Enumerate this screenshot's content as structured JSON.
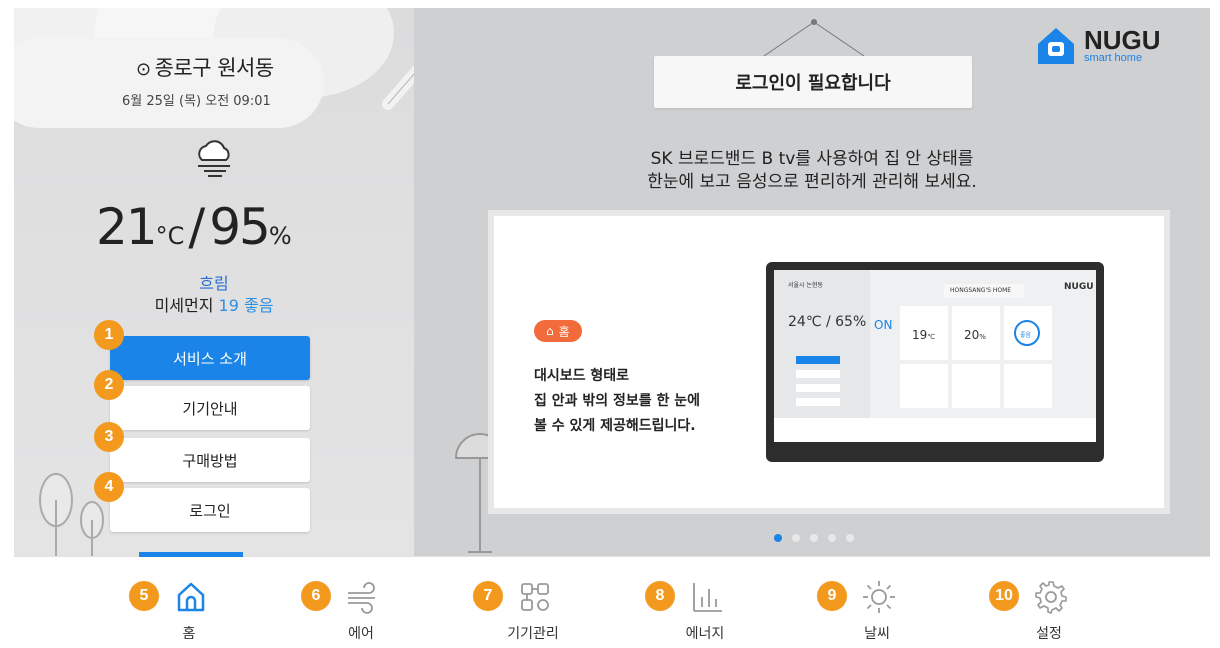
{
  "location": {
    "label": "종로구 원서동",
    "datetime": "6월 25일 (목) 오전 09:01"
  },
  "weather": {
    "temp_value": "21",
    "temp_unit": "°C",
    "humid_value": "95",
    "humid_unit": "%",
    "condition": "흐림",
    "dust_label": "미세먼지",
    "dust_value": "19 좋음"
  },
  "menu": {
    "items": [
      {
        "badge": "1",
        "label": "서비스 소개"
      },
      {
        "badge": "2",
        "label": "기기안내"
      },
      {
        "badge": "3",
        "label": "구매방법"
      },
      {
        "badge": "4",
        "label": "로그인"
      }
    ]
  },
  "main": {
    "sign": "로그인이 필요합니다",
    "desc_line1": "SK 브로드밴드 B tv를 사용하여 집 안 상태를",
    "desc_line2": "한눈에 보고 음성으로 편리하게 관리해 보세요.",
    "slide": {
      "tag": "홈",
      "line1": "대시보드 형태로",
      "line2": "집 안과 밖의 정보를 한 눈에",
      "line3": "볼 수 있게 제공해드립니다.",
      "tv": {
        "location": "서울시 논현동",
        "home_name": "HONGSANG'S HOME",
        "brand": "NUGU",
        "temp": "24℃ / 65%",
        "on_label": "ON",
        "tile1_value": "19",
        "tile1_unit": "℃",
        "tile2_value": "20",
        "tile2_unit": "%",
        "tile3_label": "좋음"
      }
    },
    "pagination": {
      "total": 5,
      "active": 1
    }
  },
  "brand": {
    "name": "NUGU",
    "sub": "smart home"
  },
  "nav": {
    "items": [
      {
        "badge": "5",
        "label": "홈",
        "icon": "home-icon"
      },
      {
        "badge": "6",
        "label": "에어",
        "icon": "wind-icon"
      },
      {
        "badge": "7",
        "label": "기기관리",
        "icon": "devices-icon"
      },
      {
        "badge": "8",
        "label": "에너지",
        "icon": "energy-chart-icon"
      },
      {
        "badge": "9",
        "label": "날씨",
        "icon": "sun-icon"
      },
      {
        "badge": "10",
        "label": "설정",
        "icon": "gear-icon"
      }
    ]
  },
  "colors": {
    "accent": "#1a84e8",
    "badge": "#f39a1e",
    "tag": "#f26b3a"
  }
}
